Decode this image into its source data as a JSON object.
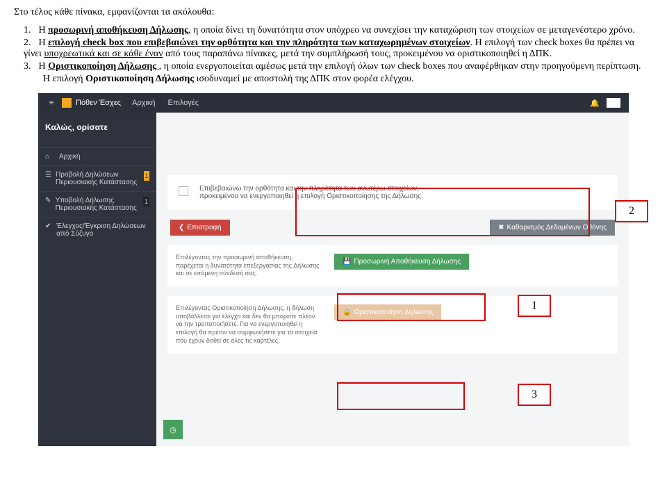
{
  "intro": "Στο τέλος κάθε πίνακα, εμφανίζονται τα ακόλουθα:",
  "items": {
    "n1": "1.",
    "t1a": "Η ",
    "t1b": "προσωρινή αποθήκευση Δήλωσης",
    "t1c": ", η οποία δίνει τη δυνατότητα στον υπόχρεο να συνεχίσει την καταχώριση των στοιχείων σε μεταγενέστερο χρόνο.",
    "n2": "2.",
    "t2a": "Η ",
    "t2b": "επιλογή check box που επιβεβαιώνει την ορθότητα και την πληρότητα των καταχωρημένων  στοιχείων",
    "t2c": ". Η επιλογή των check boxes θα πρέπει να γίνει ",
    "t2d": "υποχρεωτικά και σε κάθε έναν",
    "t2e": " από τους παραπάνω πίνακες, μετά την συμπλήρωσή τους, προκειμένου να  οριστικοποιηθεί η ΔΠΚ.",
    "n3": "3.",
    "t3a": "Η ",
    "t3b": "Οριστικοποίηση Δήλωσης ",
    "t3c": ", η οποία ενεργοποιείται αμέσως μετά την επιλογή όλων των check boxes που αναφέρθηκαν στην προηγούμενη περίπτωση.",
    "t3d": "Η επιλογή ",
    "t3e": "Οριστικοποίηση Δήλωσης",
    "t3f": " ισοδυναμεί με αποστολή της ΔΠΚ στον φορέα ελέγχου."
  },
  "topbar": {
    "brand": "Πόθεν Έσχες",
    "nav1": "Αρχική",
    "nav2": "Επιλογές"
  },
  "sidebar": {
    "welcome": "Καλώς, ορίσατε",
    "home": "Αρχική",
    "view": "Προβολή Δηλώσεων Περιουσιακής Κατάστασης",
    "submit": "Υποβολή Δήλωσης Περιουσιακής Κατάστασης",
    "approve": "Έλεγχος/Έγκριση Δηλώσεων από Σύζυγο",
    "badge1": "1",
    "badge2": "1"
  },
  "confirm_text": "Επιβεβαιώνω την ορθότητα και την πληρότητα των ανωτέρω στοιχείων, προκειμένου να ενεργοποιηθεί η επιλογή Οριστικοποίησης της Δήλωσης.",
  "btn_back": "Επιστροφή",
  "btn_clear": "Καθαρισμός Δεδομένων Οθόνης",
  "save_desc": "Επιλέγοντας την προσωρινή αποθήκευση, παρέχεται η δυνατότητα επεξεργασίας της Δήλωσης και σε επόμενη σύνδεσή σας.",
  "btn_save": "Προσωρινή Αποθήκευση Δήλωσης",
  "final_desc": "Επιλέγοντας Οριστικοποίηση Δήλωσης, η δήλωση υποβάλλεται για έλεγχο και δεν θα μπορείτε πλέον να την τροποποιήσετε. Για να ενεργοποιηθεί η επιλογή θα πρέπει να συμφωνήσετε για τα στοιχεία που έχουν δοθεί σε όλες τις καρτέλες.",
  "btn_final": "Οριστικοποίηση Δήλωσης",
  "labels": {
    "l1": "1",
    "l2": "2",
    "l3": "3"
  }
}
